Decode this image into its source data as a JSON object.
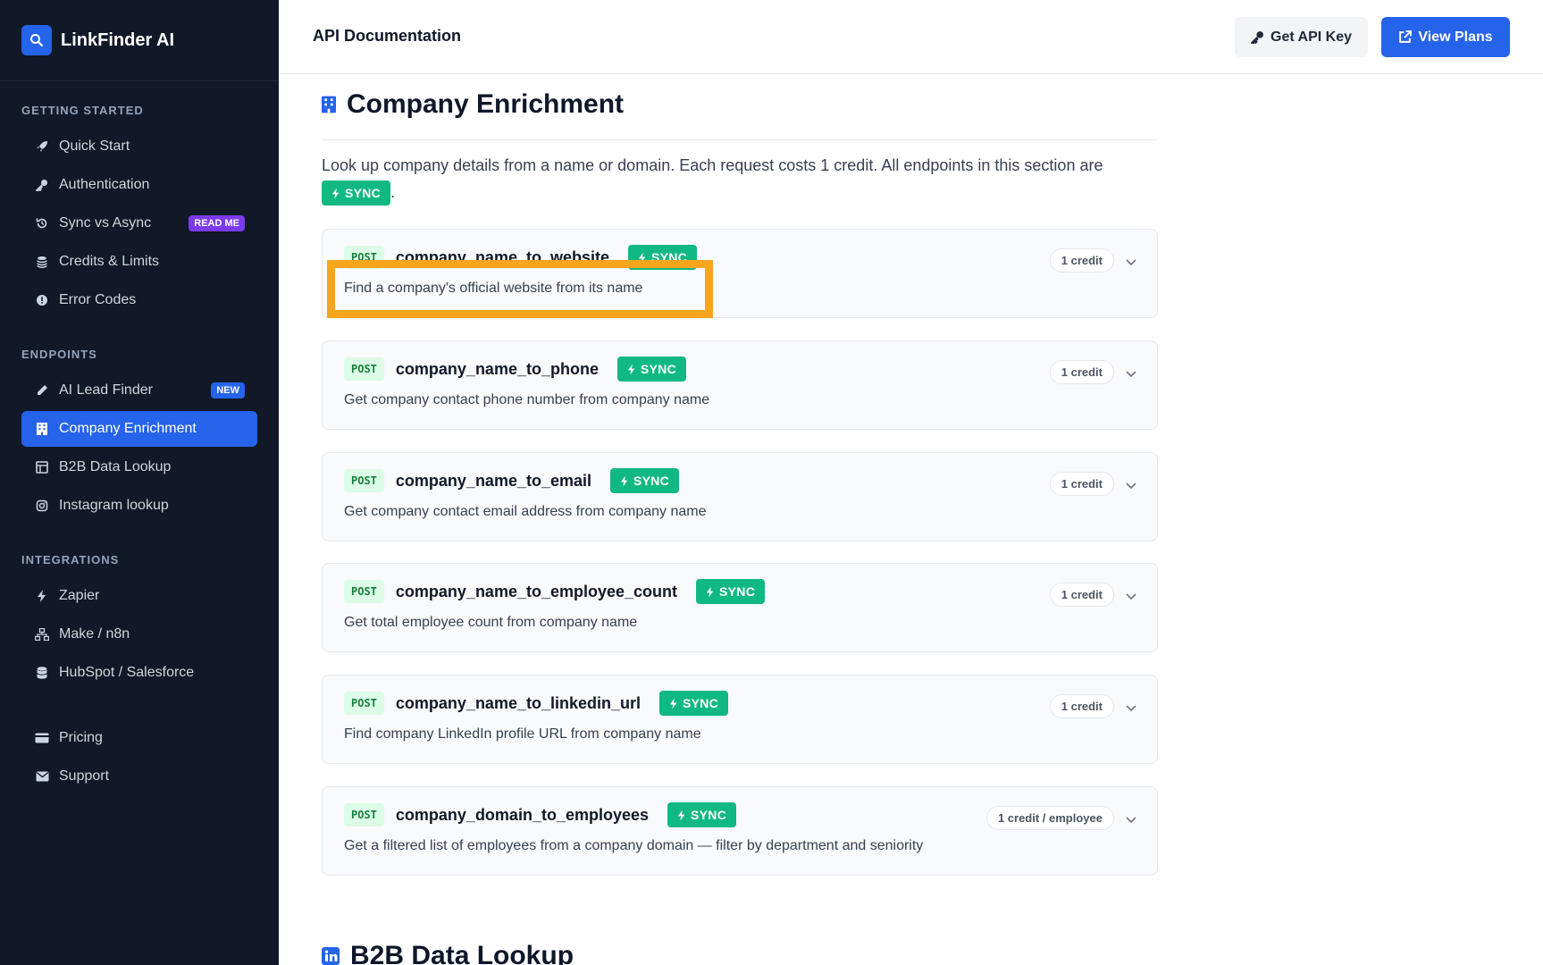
{
  "brand": {
    "name": "LinkFinder AI",
    "icon": "search-icon"
  },
  "sidebar": {
    "sections": [
      {
        "title": "GETTING STARTED",
        "items": [
          {
            "label": "Quick Start",
            "icon": "rocket-icon"
          },
          {
            "label": "Authentication",
            "icon": "key-icon"
          },
          {
            "label": "Sync vs Async",
            "icon": "history-icon",
            "badge": "READ ME"
          },
          {
            "label": "Credits & Limits",
            "icon": "coins-icon"
          },
          {
            "label": "Error Codes",
            "icon": "alert-icon"
          }
        ]
      },
      {
        "title": "ENDPOINTS",
        "items": [
          {
            "label": "AI Lead Finder",
            "icon": "pencil-icon",
            "badge": "NEW"
          },
          {
            "label": "Company Enrichment",
            "icon": "building-icon",
            "active": true
          },
          {
            "label": "B2B Data Lookup",
            "icon": "table-icon"
          },
          {
            "label": "Instagram lookup",
            "icon": "instagram-icon"
          }
        ]
      },
      {
        "title": "INTEGRATIONS",
        "items": [
          {
            "label": "Zapier",
            "icon": "bolt-icon"
          },
          {
            "label": "Make / n8n",
            "icon": "network-icon"
          },
          {
            "label": "HubSpot / Salesforce",
            "icon": "database-icon"
          }
        ]
      },
      {
        "title": "",
        "items": [
          {
            "label": "Pricing",
            "icon": "card-icon"
          },
          {
            "label": "Support",
            "icon": "envelope-icon"
          }
        ]
      }
    ]
  },
  "topbar": {
    "title": "API Documentation",
    "get_api_key": "Get API Key",
    "view_plans": "View Plans"
  },
  "section": {
    "title": "Company Enrichment",
    "description": "Look up company details from a name or domain. Each request costs 1 credit. All endpoints in this section are",
    "badge": "SYNC",
    "trail": "."
  },
  "endpoints": [
    {
      "method": "POST",
      "name": "company_name_to_website",
      "badge": "SYNC",
      "credit": "1 credit",
      "description": "Find a company's official website from its name"
    },
    {
      "method": "POST",
      "name": "company_name_to_phone",
      "badge": "SYNC",
      "credit": "1 credit",
      "description": "Get company contact phone number from company name"
    },
    {
      "method": "POST",
      "name": "company_name_to_email",
      "badge": "SYNC",
      "credit": "1 credit",
      "description": "Get company contact email address from company name"
    },
    {
      "method": "POST",
      "name": "company_name_to_employee_count",
      "badge": "SYNC",
      "credit": "1 credit",
      "description": "Get total employee count from company name"
    },
    {
      "method": "POST",
      "name": "company_name_to_linkedin_url",
      "badge": "SYNC",
      "credit": "1 credit",
      "description": "Find company LinkedIn profile URL from company name"
    },
    {
      "method": "POST",
      "name": "company_domain_to_employees",
      "badge": "SYNC",
      "credit": "1 credit / employee",
      "description": "Get a filtered list of employees from a company domain — filter by department and seniority"
    }
  ],
  "next_section": {
    "title": "B2B Data Lookup"
  },
  "colors": {
    "accent": "#2563eb",
    "sync": "#10b981",
    "sidebar": "#111827",
    "highlight": "#f7a51d"
  }
}
